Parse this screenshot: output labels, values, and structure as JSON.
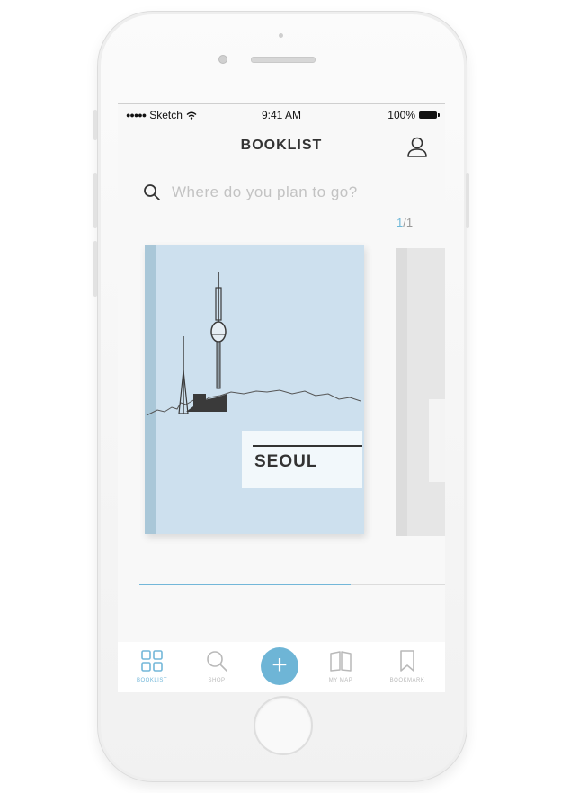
{
  "status_bar": {
    "carrier": "Sketch",
    "time": "9:41 AM",
    "battery": "100%"
  },
  "header": {
    "title": "BOOKLIST"
  },
  "search": {
    "placeholder": "Where do you plan to go?"
  },
  "pager": {
    "current": "1",
    "total": "/1"
  },
  "books": [
    {
      "title": "SEOUL"
    }
  ],
  "progress": {
    "fraction": 0.69
  },
  "colors": {
    "accent": "#73b7d9",
    "book_cover": "#cde0ee"
  },
  "tabbar": {
    "items": [
      {
        "label": "BOOKLIST",
        "icon": "grid-icon",
        "active": true
      },
      {
        "label": "SHOP",
        "icon": "search-icon",
        "active": false
      },
      {
        "label": "+",
        "icon": "plus-icon",
        "active": false
      },
      {
        "label": "MY MAP",
        "icon": "map-book-icon",
        "active": false
      },
      {
        "label": "BOOKMARK",
        "icon": "bookmark-icon",
        "active": false
      }
    ]
  }
}
